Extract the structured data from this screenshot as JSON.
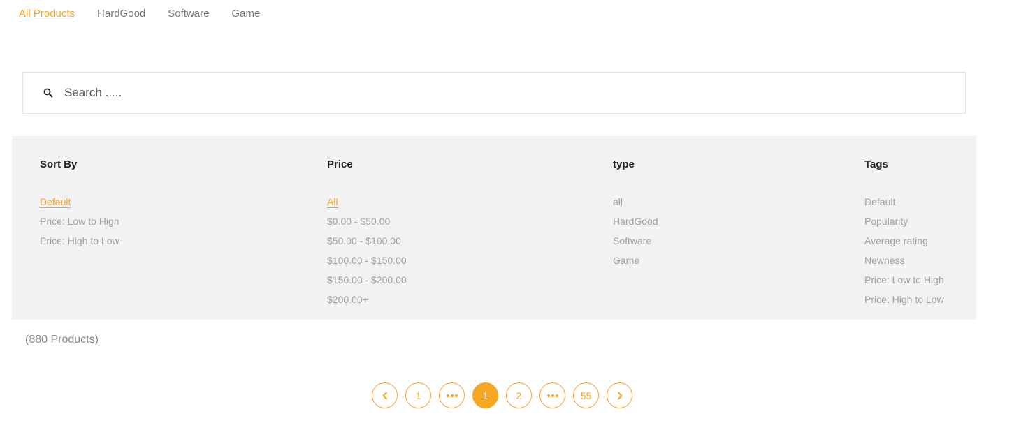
{
  "tabs": [
    {
      "label": "All Products"
    },
    {
      "label": "HardGood"
    },
    {
      "label": "Software"
    },
    {
      "label": "Game"
    }
  ],
  "search": {
    "placeholder": "Search ....."
  },
  "filters": {
    "sort_by": {
      "title": "Sort By",
      "items": [
        "Default",
        "Price: Low to High",
        "Price: High to Low"
      ],
      "selected": "Default"
    },
    "price": {
      "title": "Price",
      "items": [
        "All",
        "$0.00 - $50.00",
        "$50.00 - $100.00",
        "$100.00 - $150.00",
        "$150.00 - $200.00",
        "$200.00+"
      ],
      "selected": "All"
    },
    "type": {
      "title": "type",
      "items": [
        "all",
        "HardGood",
        "Software",
        "Game"
      ]
    },
    "tags": {
      "title": "Tags",
      "items": [
        "Default",
        "Popularity",
        "Average rating",
        "Newness",
        "Price: Low to High",
        "Price: High to Low"
      ]
    }
  },
  "product_count": "(880 Products)",
  "pagination": {
    "pages": [
      "1",
      "2",
      "55"
    ],
    "current": "1"
  },
  "colors": {
    "accent": "#f5a623"
  }
}
